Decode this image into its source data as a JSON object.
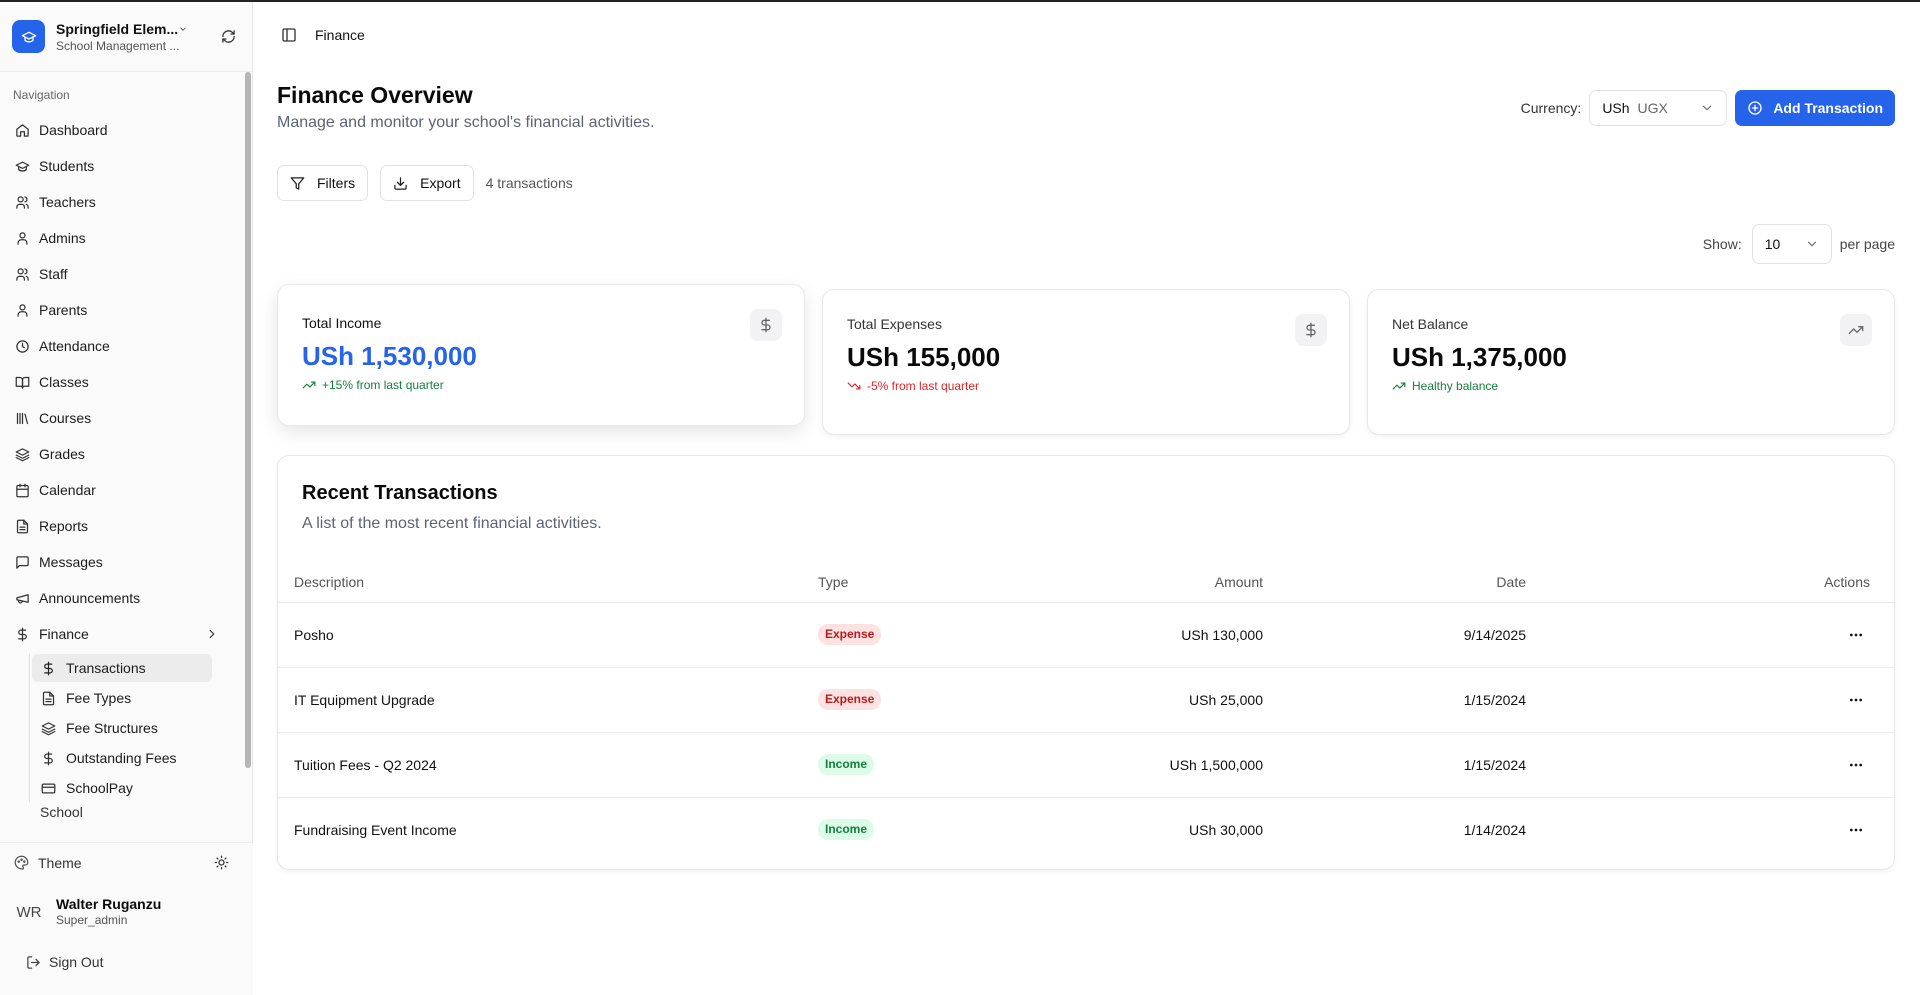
{
  "school": {
    "name": "Springfield Elem...",
    "subtitle": "School Management ..."
  },
  "nav": {
    "section_label": "Navigation",
    "items": [
      {
        "label": "Dashboard",
        "icon": "home-icon"
      },
      {
        "label": "Students",
        "icon": "graduation-cap-icon"
      },
      {
        "label": "Teachers",
        "icon": "users-icon"
      },
      {
        "label": "Admins",
        "icon": "user-icon"
      },
      {
        "label": "Staff",
        "icon": "users-icon"
      },
      {
        "label": "Parents",
        "icon": "user-icon"
      },
      {
        "label": "Attendance",
        "icon": "clock-icon"
      },
      {
        "label": "Classes",
        "icon": "book-open-icon"
      },
      {
        "label": "Courses",
        "icon": "library-icon"
      },
      {
        "label": "Grades",
        "icon": "layers-icon"
      },
      {
        "label": "Calendar",
        "icon": "calendar-icon"
      },
      {
        "label": "Reports",
        "icon": "file-text-icon"
      },
      {
        "label": "Messages",
        "icon": "message-square-icon"
      },
      {
        "label": "Announcements",
        "icon": "megaphone-icon"
      },
      {
        "label": "Finance",
        "icon": "dollar-icon"
      }
    ],
    "finance_sub": [
      {
        "label": "Transactions",
        "icon": "dollar-icon",
        "active": true
      },
      {
        "label": "Fee Types",
        "icon": "file-text-icon"
      },
      {
        "label": "Fee Structures",
        "icon": "layers-icon"
      },
      {
        "label": "Outstanding Fees",
        "icon": "dollar-icon"
      },
      {
        "label": "SchoolPay",
        "icon": "credit-card-icon"
      }
    ],
    "cut_item": "School"
  },
  "footer": {
    "theme_label": "Theme",
    "user_initials": "WR",
    "user_name": "Walter Ruganzu",
    "user_role": "Super_admin",
    "sign_out": "Sign Out"
  },
  "breadcrumb": "Finance",
  "page": {
    "title": "Finance Overview",
    "subtitle": "Manage and monitor your school's financial activities.",
    "currency_label": "Currency:",
    "currency_symbol": "USh",
    "currency_code": "UGX",
    "add_button": "Add Transaction",
    "filters_button": "Filters",
    "export_button": "Export",
    "tx_count": "4 transactions",
    "show_label": "Show:",
    "per_page_value": "10",
    "per_page_label": "per page"
  },
  "stats": [
    {
      "label": "Total Income",
      "value": "USh 1,530,000",
      "trend": "+15% from last quarter",
      "direction": "up",
      "icon": "dollar-icon"
    },
    {
      "label": "Total Expenses",
      "value": "USh 155,000",
      "trend": "-5% from last quarter",
      "direction": "down",
      "icon": "dollar-icon"
    },
    {
      "label": "Net Balance",
      "value": "USh 1,375,000",
      "trend": "Healthy balance",
      "direction": "up",
      "icon": "trending-up-icon"
    }
  ],
  "transactions": {
    "title": "Recent Transactions",
    "subtitle": "A list of the most recent financial activities.",
    "columns": [
      "Description",
      "Type",
      "Amount",
      "Date",
      "Actions"
    ],
    "rows": [
      {
        "description": "Posho",
        "type": "Expense",
        "amount": "USh 130,000",
        "date": "9/14/2025"
      },
      {
        "description": "IT Equipment Upgrade",
        "type": "Expense",
        "amount": "USh 25,000",
        "date": "1/15/2024"
      },
      {
        "description": "Tuition Fees - Q2 2024",
        "type": "Income",
        "amount": "USh 1,500,000",
        "date": "1/15/2024"
      },
      {
        "description": "Fundraising Event Income",
        "type": "Income",
        "amount": "USh 30,000",
        "date": "1/14/2024"
      }
    ]
  },
  "colors": {
    "accent": "#2563eb",
    "income": "#15803d",
    "expense": "#dc2626"
  }
}
